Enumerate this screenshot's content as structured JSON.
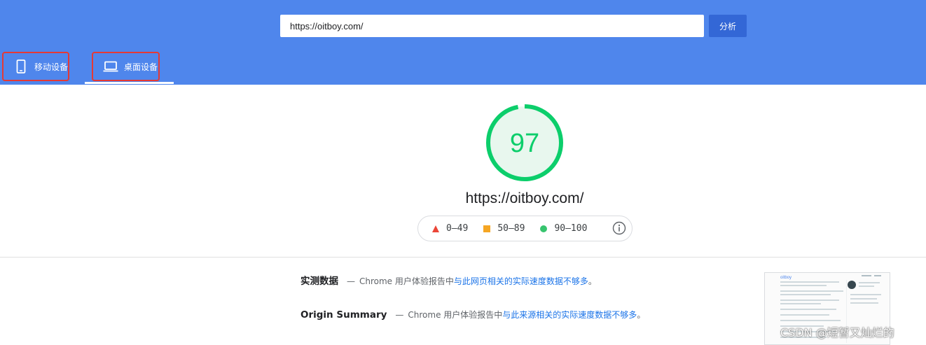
{
  "header": {
    "url_value": "https://oitboy.com/",
    "analyze_label": "分析",
    "tabs": [
      {
        "label": "移动设备",
        "icon": "smartphone-icon",
        "selected": false
      },
      {
        "label": "桌面设备",
        "icon": "laptop-icon",
        "selected": true
      }
    ]
  },
  "score": {
    "value": "97",
    "progress": 0.97,
    "color": "#0cce6b",
    "url": "https://oitboy.com/"
  },
  "legend": {
    "items": [
      {
        "range": "0–49",
        "icon": "triangle-icon",
        "color": "#eb4537"
      },
      {
        "range": "50–89",
        "icon": "square-icon",
        "color": "#f5a623"
      },
      {
        "range": "90–100",
        "icon": "circle-icon",
        "color": "#37c46e"
      }
    ],
    "info_icon": "info-icon"
  },
  "field_data": {
    "title": "实测数据",
    "dash": "—",
    "text": "Chrome 用户体验报告中",
    "link": "与此网页相关的实际速度数据不够多",
    "suffix": "。"
  },
  "origin_summary": {
    "title": "Origin Summary",
    "dash": "—",
    "text": "Chrome 用户体验报告中",
    "link": "与此来源相关的实际速度数据不够多",
    "suffix": "。"
  },
  "thumbnail": {
    "brand": "oitboy"
  },
  "watermark": "CSDN @短暂又灿烂的",
  "colors": {
    "header_bg": "#4f86ec",
    "button_bg": "#3367d6",
    "highlight_border": "#e53935",
    "link": "#1a73e8"
  }
}
